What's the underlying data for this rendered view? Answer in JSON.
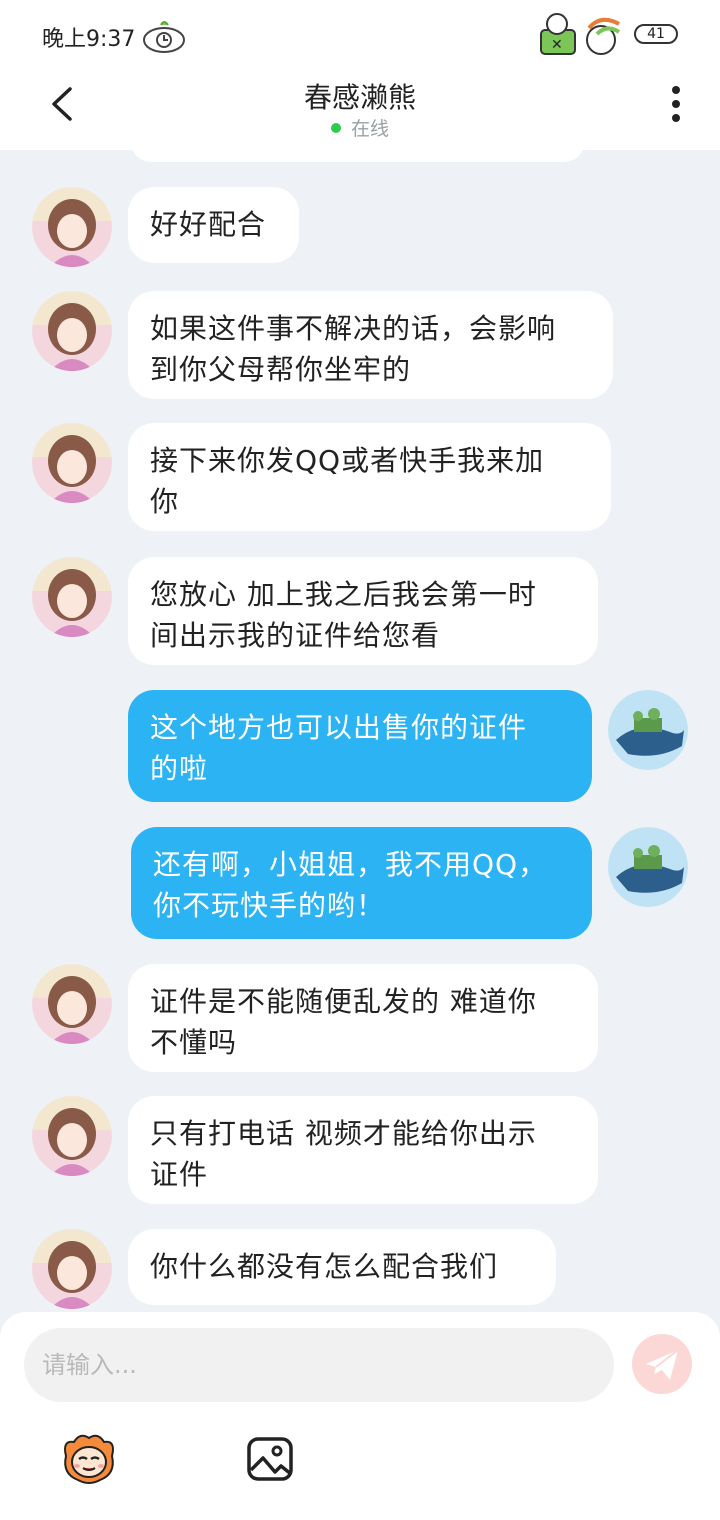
{
  "status_bar": {
    "time": "晚上9:37",
    "battery": "41"
  },
  "header": {
    "title": "春感濑熊",
    "status": "在线"
  },
  "messages": [
    {
      "side": "left",
      "lines": [
        "好好配合"
      ]
    },
    {
      "side": "left",
      "lines": [
        "如果这件事不解决的话，会影响",
        "到你父母帮你坐牢的"
      ]
    },
    {
      "side": "left",
      "lines": [
        "接下来你发QQ或者快手我来加",
        "你"
      ]
    },
    {
      "side": "left",
      "lines": [
        "您放心 加上我之后我会第一时",
        "间出示我的证件给您看"
      ]
    },
    {
      "side": "right",
      "lines": [
        "这个地方也可以出售你的证件",
        "的啦"
      ]
    },
    {
      "side": "right",
      "lines": [
        "还有啊，小姐姐，我不用QQ，",
        "你不玩快手的哟！"
      ]
    },
    {
      "side": "left",
      "lines": [
        "证件是不能随便乱发的 难道你",
        "不懂吗"
      ]
    },
    {
      "side": "left",
      "lines": [
        "只有打电话 视频才能给你出示",
        "证件"
      ]
    },
    {
      "side": "left",
      "lines": [
        "你什么都没有怎么配合我们"
      ]
    }
  ],
  "input": {
    "placeholder": "请输入..."
  },
  "icons": {
    "back": "chevron-left-icon",
    "more": "more-vertical-icon",
    "send": "paper-plane-icon",
    "emoji": "emoji-face-icon",
    "image": "image-icon"
  },
  "colors": {
    "outgoing_bubble": "#2bb3f3",
    "incoming_bubble": "#ffffff",
    "background": "#eef1f5",
    "online": "#2ecc4a",
    "send_button": "#fbd8d6"
  }
}
